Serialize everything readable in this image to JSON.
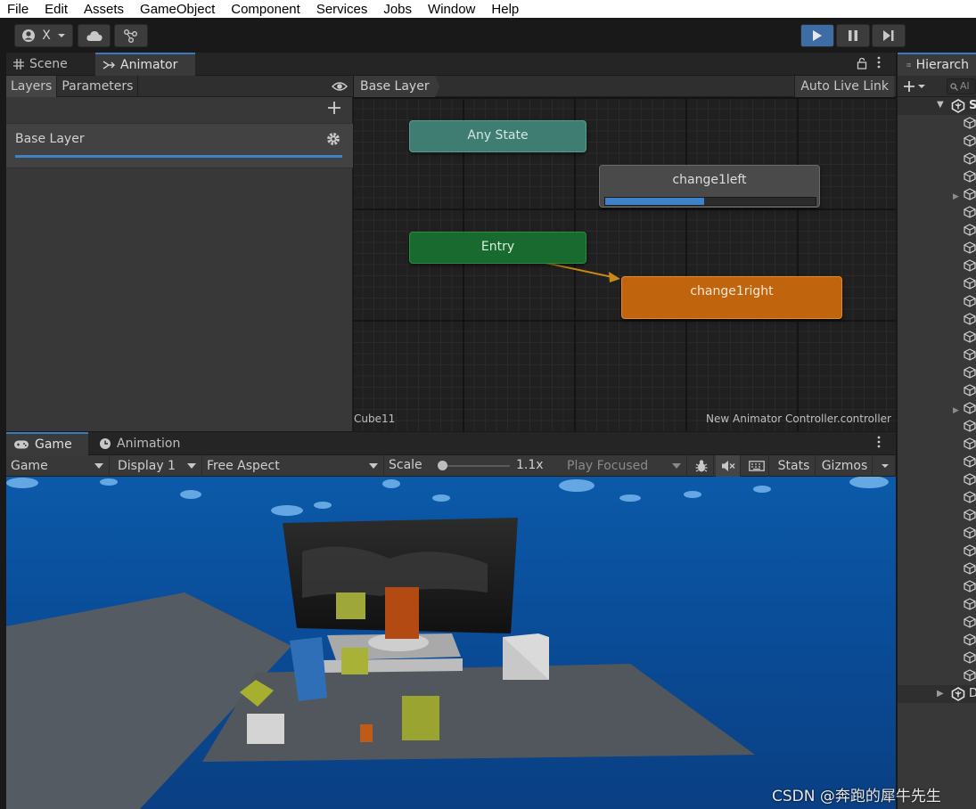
{
  "menu": [
    "File",
    "Edit",
    "Assets",
    "GameObject",
    "Component",
    "Services",
    "Jobs",
    "Window",
    "Help"
  ],
  "toolbar": {
    "account_label": "X"
  },
  "animator_panel": {
    "tabs": [
      {
        "label": "Scene"
      },
      {
        "label": "Animator"
      }
    ],
    "left_tabs": {
      "layers": "Layers",
      "parameters": "Parameters"
    },
    "layer": {
      "name": "Base Layer"
    },
    "breadcrumb": "Base Layer",
    "auto_live_link": "Auto Live Link",
    "states": {
      "any_state": "Any State",
      "entry": "Entry",
      "change_left": "change1left",
      "change_right": "change1right"
    },
    "playback_progress": 0.47,
    "status_object": "Cube11",
    "status_controller": "New Animator Controller.controller",
    "colors": {
      "any_state": "#3f7d73",
      "entry": "#196a2f",
      "default_state": "#c0650e",
      "transition": "#c88a12",
      "accent": "#3e82c9"
    }
  },
  "hierarchy": {
    "tab_label": "Hierarch",
    "search_placeholder": "Al",
    "scene_initial": "S",
    "bottom_initial": "D"
  },
  "game_panel": {
    "tabs": [
      {
        "label": "Game"
      },
      {
        "label": "Animation"
      }
    ],
    "view_dropdown": "Game",
    "display": "Display 1",
    "aspect": "Free Aspect",
    "scale_label": "Scale",
    "scale_value": "1.1x",
    "scale_level": 0.05,
    "play_focused": "Play Focused",
    "stats": "Stats",
    "gizmos": "Gizmos"
  },
  "watermark": "CSDN @奔跑的犀牛先生"
}
